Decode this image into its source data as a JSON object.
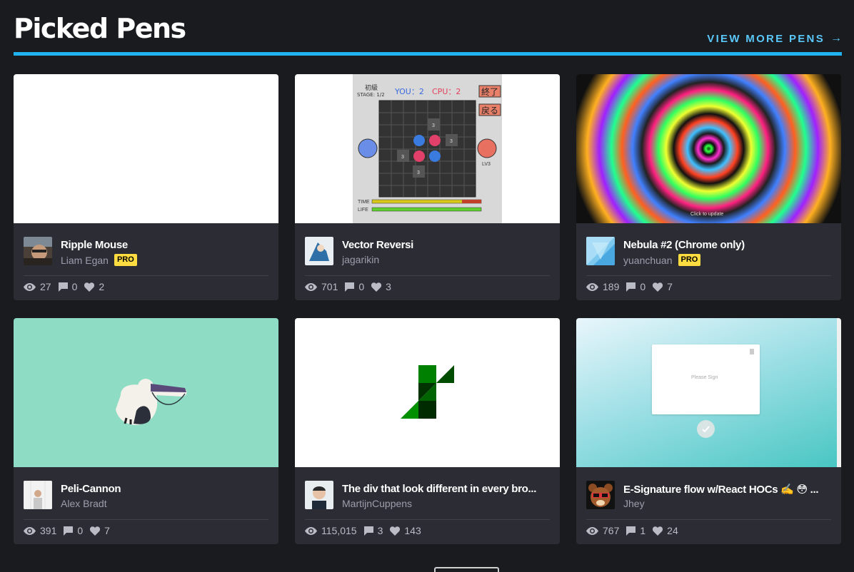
{
  "header": {
    "title": "Picked Pens",
    "view_more": "VIEW MORE PENS",
    "view_more_arrow": "→"
  },
  "cards": [
    {
      "title": "Ripple Mouse",
      "author": "Liam Egan",
      "pro": "PRO",
      "views": "27",
      "comments": "0",
      "hearts": "2"
    },
    {
      "title": "Vector Reversi",
      "author": "jagarikin",
      "views": "701",
      "comments": "0",
      "hearts": "3",
      "game": {
        "level": "初級",
        "stage": "STAGE: 1/2",
        "you": "YOU：2",
        "cpu": "CPU：2",
        "btn_end": "終了",
        "btn_back": "戻る",
        "lv": "LV3",
        "time": "TIME",
        "life": "LIFE",
        "cell_value": "3"
      }
    },
    {
      "title": "Nebula #2 (Chrome only)",
      "author": "yuanchuan",
      "pro": "PRO",
      "views": "189",
      "comments": "0",
      "hearts": "7",
      "hint": "Click to update"
    },
    {
      "title": "Peli-Cannon",
      "author": "Alex Bradt",
      "views": "391",
      "comments": "0",
      "hearts": "7"
    },
    {
      "title": "The div that look different in every bro...",
      "author": "MartijnCuppens",
      "views": "115,015",
      "comments": "3",
      "hearts": "143"
    },
    {
      "title": "E-Signature flow w/React HOCs ✍️ 😳 ...",
      "author": "Jhey",
      "views": "767",
      "comments": "1",
      "hearts": "24",
      "sign_placeholder": "Please Sign"
    }
  ],
  "colors": {
    "accent": "#1fb4f0",
    "pro_badge": "#ffdd40",
    "card_bg": "#2c2d34",
    "page_bg": "#1a1b1f"
  },
  "icons": {
    "views": "eye-icon",
    "comments": "comment-icon",
    "hearts": "heart-icon",
    "arrow": "arrow-right-icon"
  }
}
